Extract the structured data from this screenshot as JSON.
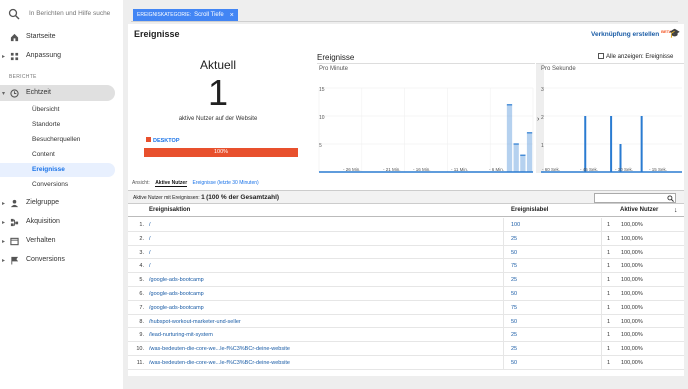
{
  "search": {
    "placeholder": "In Berichten und Hilfe suche"
  },
  "nav": {
    "startseite": "Startseite",
    "anpassung": "Anpassung",
    "berichte": "BERICHTE",
    "echtzeit": "Echtzeit",
    "echtzeit_sub": [
      "Übersicht",
      "Standorte",
      "Besucherquellen",
      "Content",
      "Ereignisse",
      "Conversions"
    ],
    "zielgruppe": "Zielgruppe",
    "akquisition": "Akquisition",
    "verhalten": "Verhalten",
    "conversions": "Conversions"
  },
  "filter": {
    "key": "EREIGNISKATEGORIE:",
    "value": "Scroll Tiefe",
    "close": "×"
  },
  "header": {
    "title": "Ereignisse",
    "link": "Verknüpfung erstellen",
    "beta": "BETA"
  },
  "summary": {
    "heading": "Aktuell",
    "count": "1",
    "caption": "aktive Nutzer auf der Website",
    "device": "DESKTOP",
    "device_percent": "100%",
    "device_fraction": 1.0
  },
  "events": {
    "title": "Ereignisse",
    "show_all": "Alle anzeigen: Ereignisse"
  },
  "charts": [
    {
      "title": "Pro Minute",
      "yticks": [
        "15",
        "10",
        "5"
      ],
      "xticks": [
        "- 26 Min.",
        "- 21 Min.",
        "- 16 Min.",
        "- 11 Min.",
        "- 6 Min."
      ],
      "values": [
        0,
        0,
        0,
        0,
        0,
        0,
        0,
        0,
        0,
        0,
        0,
        0,
        0,
        0,
        0,
        0,
        0,
        0,
        0,
        0,
        0,
        0,
        0,
        0,
        0,
        0,
        0,
        0,
        12,
        5,
        3,
        7
      ]
    },
    {
      "title": "Pro Sekunde",
      "yticks": [
        "3",
        "2",
        "1"
      ],
      "xticks": [
        "- 60 Sek.",
        "- 45 Sek.",
        "- 30 Sek.",
        "- 15 Sek."
      ],
      "bars": [
        {
          "sec": -45,
          "v": 2
        },
        {
          "sec": -34,
          "v": 2
        },
        {
          "sec": -30,
          "v": 1
        },
        {
          "sec": -21,
          "v": 2
        }
      ]
    }
  ],
  "chart_data": [
    {
      "type": "bar",
      "title": "Pro Minute",
      "xticks": [
        "- 26 Min.",
        "- 21 Min.",
        "- 16 Min.",
        "- 11 Min.",
        "- 6 Min."
      ],
      "values": [
        12,
        5,
        3,
        7
      ],
      "ylim": [
        0,
        15
      ]
    },
    {
      "type": "bar",
      "title": "Pro Sekunde",
      "x": [
        -45,
        -34,
        -30,
        -21
      ],
      "values": [
        2,
        2,
        1,
        2
      ],
      "ylim": [
        0,
        3
      ]
    }
  ],
  "view": {
    "label": "Ansicht:",
    "tab_active": "Aktive Nutzer",
    "tab_other": "Ereignisse (letzte 30 Minuten)"
  },
  "table": {
    "summary_prefix": "Aktive Nutzer mit Ereignissen:",
    "summary_value": "1",
    "summary_suffix": "(100 % der Gesamtzahl)",
    "col_action": "Ereignisaktion",
    "col_label": "Ereignislabel",
    "col_users": "Aktive Nutzer",
    "rows": [
      {
        "n": "1.",
        "action": "/",
        "label": "100",
        "users": "1",
        "pct": "100,00%"
      },
      {
        "n": "2.",
        "action": "/",
        "label": "25",
        "users": "1",
        "pct": "100,00%"
      },
      {
        "n": "3.",
        "action": "/",
        "label": "50",
        "users": "1",
        "pct": "100,00%"
      },
      {
        "n": "4.",
        "action": "/",
        "label": "75",
        "users": "1",
        "pct": "100,00%"
      },
      {
        "n": "5.",
        "action": "/google-ads-bootcamp",
        "label": "25",
        "users": "1",
        "pct": "100,00%"
      },
      {
        "n": "6.",
        "action": "/google-ads-bootcamp",
        "label": "50",
        "users": "1",
        "pct": "100,00%"
      },
      {
        "n": "7.",
        "action": "/google-ads-bootcamp",
        "label": "75",
        "users": "1",
        "pct": "100,00%"
      },
      {
        "n": "8.",
        "action": "/hubspot-workout-marketer-und-seller",
        "label": "50",
        "users": "1",
        "pct": "100,00%"
      },
      {
        "n": "9.",
        "action": "/lead-nurturing-mit-system",
        "label": "25",
        "users": "1",
        "pct": "100,00%"
      },
      {
        "n": "10.",
        "action": "/was-bedeuten-die-core-we...le-f%C3%BCr-deine-website",
        "label": "25",
        "users": "1",
        "pct": "100,00%"
      },
      {
        "n": "11.",
        "action": "/was-bedeuten-die-core-we...le-f%C3%BCr-deine-website",
        "label": "50",
        "users": "1",
        "pct": "100,00%"
      }
    ]
  }
}
